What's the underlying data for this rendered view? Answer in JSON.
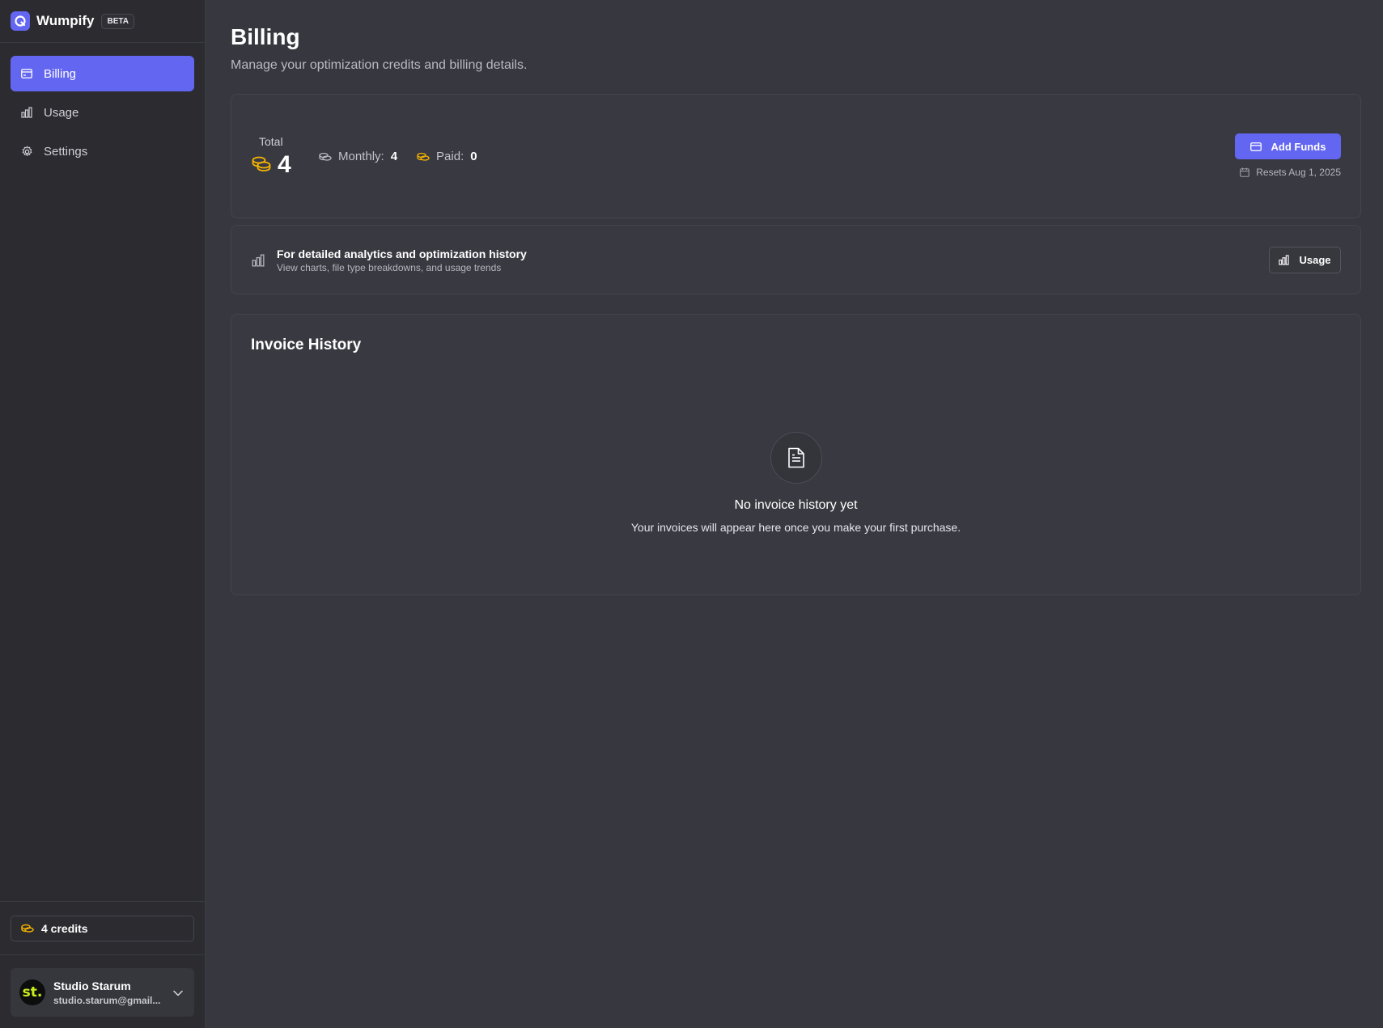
{
  "brand": {
    "name": "Wumpify",
    "badge": "BETA"
  },
  "sidebar": {
    "items": [
      {
        "label": "Billing",
        "icon": "credit-card-icon",
        "active": true
      },
      {
        "label": "Usage",
        "icon": "bar-chart-icon",
        "active": false
      },
      {
        "label": "Settings",
        "icon": "gear-icon",
        "active": false
      }
    ],
    "credits_label": "4 credits",
    "user": {
      "name": "Studio Starum",
      "email": "studio.starum@gmail...",
      "avatar_text": "st."
    }
  },
  "page": {
    "title": "Billing",
    "subtitle": "Manage your optimization credits and billing details."
  },
  "balance": {
    "total_label": "Total",
    "total_value": "4",
    "monthly_label": "Monthly:",
    "monthly_value": "4",
    "paid_label": "Paid:",
    "paid_value": "0",
    "add_funds_label": "Add Funds",
    "resets_text": "Resets Aug 1, 2025"
  },
  "analytics": {
    "title": "For detailed analytics and optimization history",
    "subtitle": "View charts, file type breakdowns, and usage trends",
    "button_label": "Usage"
  },
  "invoices": {
    "title": "Invoice History",
    "empty_title": "No invoice history yet",
    "empty_subtitle": "Your invoices will appear here once you make your first purchase."
  },
  "colors": {
    "accent": "#6366f1",
    "coin": "#f5b400",
    "background": "#37373f",
    "sidebar": "#2b2b30"
  }
}
